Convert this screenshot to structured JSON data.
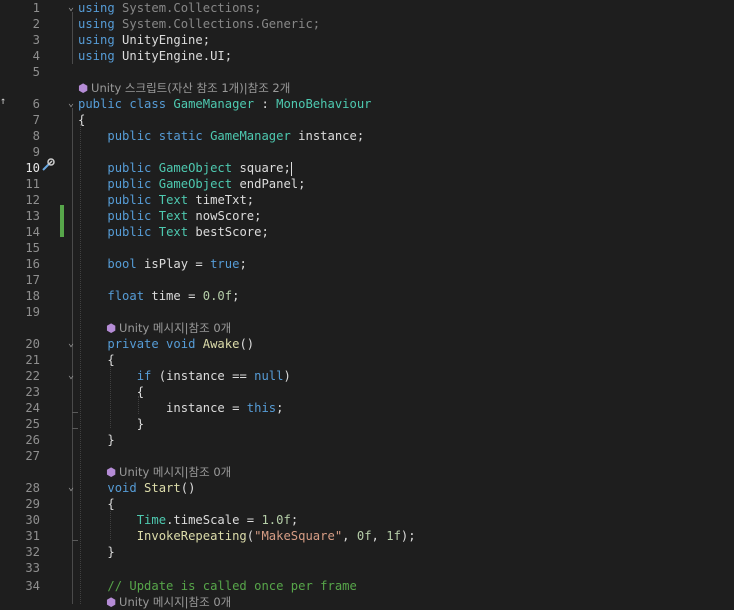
{
  "editor": {
    "lines": [
      {
        "n": "1",
        "tokens": [
          [
            "kw",
            "using"
          ],
          [
            "id dim",
            " System.Collections;"
          ]
        ]
      },
      {
        "n": "2",
        "tokens": [
          [
            "kw",
            "using"
          ],
          [
            "id dim",
            " System.Collections.Generic;"
          ]
        ]
      },
      {
        "n": "3",
        "tokens": [
          [
            "kw",
            "using"
          ],
          [
            "id",
            " UnityEngine;"
          ]
        ]
      },
      {
        "n": "4",
        "tokens": [
          [
            "kw",
            "using"
          ],
          [
            "id",
            " UnityEngine.UI;"
          ]
        ]
      },
      {
        "n": "5",
        "tokens": []
      },
      {
        "lens": "Unity 스크립트(자산 참조 1개)|참조 2개"
      },
      {
        "n": "6",
        "tokens": [
          [
            "kw",
            "public class "
          ],
          [
            "ty",
            "GameManager"
          ],
          [
            "id",
            " : "
          ],
          [
            "ty",
            "MonoBehaviour"
          ]
        ]
      },
      {
        "n": "7",
        "tokens": [
          [
            "id",
            "{"
          ]
        ]
      },
      {
        "n": "8",
        "tokens": [
          [
            "id",
            "    "
          ],
          [
            "kw",
            "public static "
          ],
          [
            "ty",
            "GameManager"
          ],
          [
            "id",
            " instance;"
          ]
        ]
      },
      {
        "n": "9",
        "tokens": []
      },
      {
        "n": "10",
        "active": true,
        "tokens": [
          [
            "id",
            "    "
          ],
          [
            "kw",
            "public "
          ],
          [
            "ty",
            "GameObject"
          ],
          [
            "id",
            " square;"
          ]
        ]
      },
      {
        "n": "11",
        "tokens": [
          [
            "id",
            "    "
          ],
          [
            "kw",
            "public "
          ],
          [
            "ty",
            "GameObject"
          ],
          [
            "id",
            " endPanel;"
          ]
        ]
      },
      {
        "n": "12",
        "tokens": [
          [
            "id",
            "    "
          ],
          [
            "kw",
            "public "
          ],
          [
            "ty",
            "Text"
          ],
          [
            "id",
            " timeTxt;"
          ]
        ]
      },
      {
        "n": "13",
        "tokens": [
          [
            "id",
            "    "
          ],
          [
            "kw",
            "public "
          ],
          [
            "ty",
            "Text"
          ],
          [
            "id",
            " nowScore;"
          ]
        ]
      },
      {
        "n": "14",
        "tokens": [
          [
            "id",
            "    "
          ],
          [
            "kw",
            "public "
          ],
          [
            "ty",
            "Text"
          ],
          [
            "id",
            " bestScore;"
          ]
        ]
      },
      {
        "n": "15",
        "tokens": []
      },
      {
        "n": "16",
        "tokens": [
          [
            "id",
            "    "
          ],
          [
            "kw",
            "bool"
          ],
          [
            "id",
            " isPlay = "
          ],
          [
            "kw",
            "true"
          ],
          [
            "id",
            ";"
          ]
        ]
      },
      {
        "n": "17",
        "tokens": []
      },
      {
        "n": "18",
        "tokens": [
          [
            "id",
            "    "
          ],
          [
            "kw",
            "float"
          ],
          [
            "id",
            " time = "
          ],
          [
            "num",
            "0.0f"
          ],
          [
            "id",
            ";"
          ]
        ]
      },
      {
        "n": "19",
        "tokens": []
      },
      {
        "lens": "Unity 메시지|참조 0개",
        "indent": "    "
      },
      {
        "n": "20",
        "tokens": [
          [
            "id",
            "    "
          ],
          [
            "kw",
            "private void "
          ],
          [
            "fn",
            "Awake"
          ],
          [
            "id",
            "()"
          ]
        ]
      },
      {
        "n": "21",
        "tokens": [
          [
            "id",
            "    {"
          ]
        ]
      },
      {
        "n": "22",
        "tokens": [
          [
            "id",
            "        "
          ],
          [
            "kw",
            "if"
          ],
          [
            "id",
            " (instance == "
          ],
          [
            "kw",
            "null"
          ],
          [
            "id",
            ")"
          ]
        ]
      },
      {
        "n": "23",
        "tokens": [
          [
            "id",
            "        {"
          ]
        ]
      },
      {
        "n": "24",
        "tokens": [
          [
            "id",
            "            instance = "
          ],
          [
            "kw",
            "this"
          ],
          [
            "id",
            ";"
          ]
        ]
      },
      {
        "n": "25",
        "tokens": [
          [
            "id",
            "        }"
          ]
        ]
      },
      {
        "n": "26",
        "tokens": [
          [
            "id",
            "    }"
          ]
        ]
      },
      {
        "n": "27",
        "tokens": []
      },
      {
        "lens": "Unity 메시지|참조 0개",
        "indent": "    "
      },
      {
        "n": "28",
        "tokens": [
          [
            "id",
            "    "
          ],
          [
            "kw",
            "void "
          ],
          [
            "fn",
            "Start"
          ],
          [
            "id",
            "()"
          ]
        ]
      },
      {
        "n": "29",
        "tokens": [
          [
            "id",
            "    {"
          ]
        ]
      },
      {
        "n": "30",
        "tokens": [
          [
            "id",
            "        "
          ],
          [
            "ty",
            "Time"
          ],
          [
            "id",
            ".timeScale = "
          ],
          [
            "num",
            "1.0f"
          ],
          [
            "id",
            ";"
          ]
        ]
      },
      {
        "n": "31",
        "tokens": [
          [
            "id",
            "        "
          ],
          [
            "fn",
            "InvokeRepeating"
          ],
          [
            "id",
            "("
          ],
          [
            "str",
            "\"MakeSquare\""
          ],
          [
            "id",
            ", "
          ],
          [
            "num",
            "0f"
          ],
          [
            "id",
            ", "
          ],
          [
            "num",
            "1f"
          ],
          [
            "id",
            ");"
          ]
        ]
      },
      {
        "n": "32",
        "tokens": [
          [
            "id",
            "    }"
          ]
        ]
      },
      {
        "n": "33",
        "tokens": []
      },
      {
        "n": "34",
        "tokens": [
          [
            "id",
            "    "
          ],
          [
            "cm",
            "// Update is called once per frame"
          ]
        ]
      },
      {
        "lens": "Unity 메시지|참조 0개",
        "indent": "    "
      }
    ]
  },
  "colors": {
    "background": "#1e1e1e",
    "keyword": "#569cd6",
    "type": "#4ec9b0",
    "method": "#dcdcaa",
    "string": "#d69d85",
    "comment": "#57a64a",
    "change_bar": "#57a64a"
  }
}
